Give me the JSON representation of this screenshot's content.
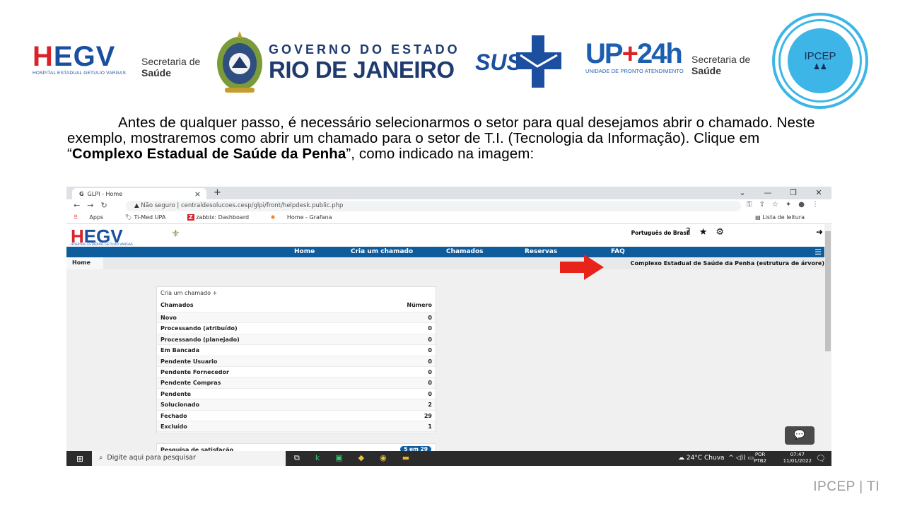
{
  "logos": {
    "hegv": {
      "mark": "HEGV",
      "subtitle": "HOSPITAL ESTADUAL GETULIO VARGAS"
    },
    "secretaria1": {
      "line1": "Secretaria de",
      "line2": "Saúde"
    },
    "governo": {
      "line1": "GOVERNO DO ESTADO",
      "line2": "RIO DE JANEIRO"
    },
    "sus": {
      "text": "SUS"
    },
    "upa": {
      "text": "UPA24h",
      "subtitle": "UNIDADE DE PRONTO ATENDIMENTO"
    },
    "secretaria2": {
      "line1": "Secretaria de",
      "line2": "Saúde"
    },
    "ipcep": {
      "text": "IPCEP"
    }
  },
  "instruction": {
    "part1": "Antes de qualquer passo, é necessário selecionarmos o setor para qual desejamos abrir o chamado. Neste exemplo, mostraremos como abrir um chamado para o setor de T.I. (Tecnologia da Informação). Clique em “",
    "bold": "Complexo Estadual de Saúde da Penha",
    "part2": "”, como indicado na imagem:"
  },
  "browser": {
    "tab_title": "GLPI - Home",
    "url_prefix": "Não seguro",
    "url": "centraldesolucoes.cesp/glpi/front/helpdesk.public.php",
    "bookmarks": [
      "Apps",
      "Ti-Med UPA",
      "zabbix: Dashboard",
      "Home - Grafana"
    ],
    "reading_list": "Lista de leitura"
  },
  "glpi": {
    "language": "Português do Brasil",
    "menu": [
      "Home",
      "Cria um chamado",
      "Chamados",
      "Reservas",
      "FAQ"
    ],
    "breadcrumb": "Home",
    "entity": "Complexo Estadual de Saúde da Penha (estrutura de árvore)",
    "create_link": "Cria um chamado",
    "table_header": {
      "label": "Chamados",
      "value": "Número"
    },
    "rows": [
      {
        "label": "Novo",
        "value": "0"
      },
      {
        "label": "Processando (atribuído)",
        "value": "0"
      },
      {
        "label": "Processando (planejado)",
        "value": "0"
      },
      {
        "label": "Em Bancada",
        "value": "0"
      },
      {
        "label": "Pendente Usuario",
        "value": "0"
      },
      {
        "label": "Pendente Fornecedor",
        "value": "0"
      },
      {
        "label": "Pendente Compras",
        "value": "0"
      },
      {
        "label": "Pendente",
        "value": "0"
      },
      {
        "label": "Solucionado",
        "value": "2"
      },
      {
        "label": "Fechado",
        "value": "29"
      },
      {
        "label": "Excluído",
        "value": "1"
      }
    ],
    "survey_label": "Pesquisa de satisfação",
    "survey_badge": "5 em 29"
  },
  "taskbar": {
    "search_placeholder": "Digite aqui para pesquisar",
    "weather": "24°C Chuva",
    "lang1": "POR",
    "lang2": "PTB2",
    "time": "07:47",
    "date": "11/01/2022"
  },
  "footer": "IPCEP | TI",
  "colors": {
    "accent": "#0f5c9c",
    "brand_red": "#d8232a",
    "ipcep_blue": "#3db5e6"
  }
}
